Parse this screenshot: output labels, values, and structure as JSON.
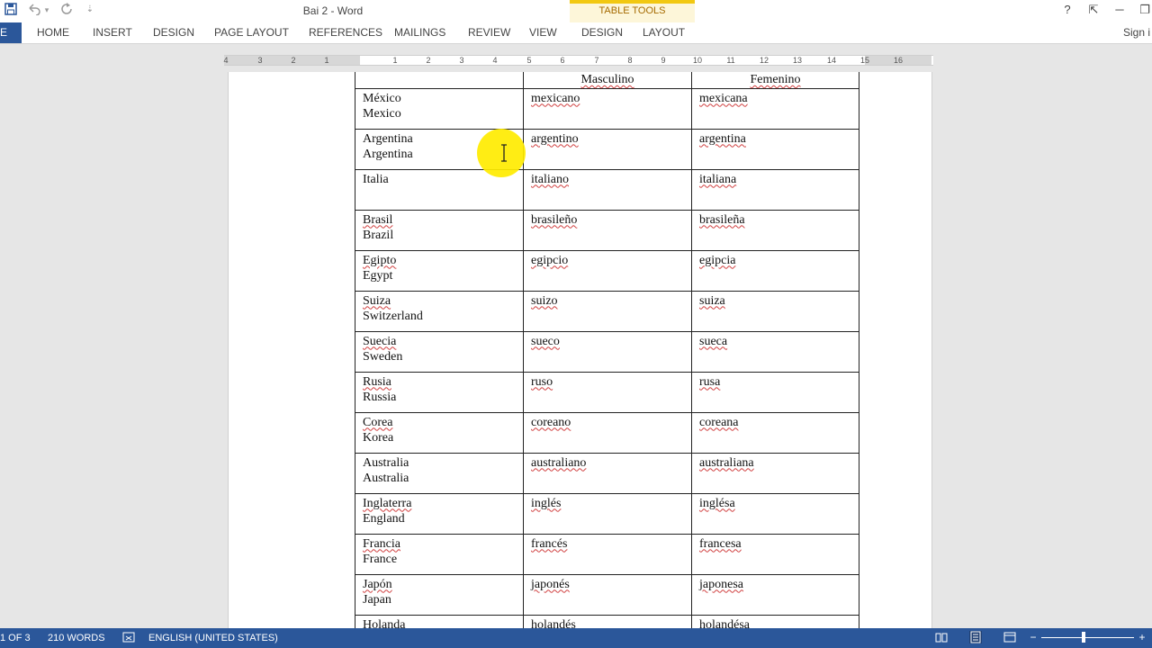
{
  "window": {
    "title": "Bai 2 - Word",
    "contextual_group": "TABLE TOOLS"
  },
  "quick_access": {
    "icons": [
      "save-icon",
      "undo-icon",
      "redo-icon",
      "customize-icon"
    ],
    "undo_dropdown": "▾",
    "customize": "⇣"
  },
  "window_controls": {
    "help": "?",
    "ribbon_display": "⇱",
    "minimize": "─",
    "restore": "❐"
  },
  "ribbon": {
    "file_tab": "E",
    "tabs": [
      "HOME",
      "INSERT",
      "DESIGN",
      "PAGE LAYOUT",
      "REFERENCES",
      "MAILINGS",
      "REVIEW",
      "VIEW"
    ],
    "context_tabs": [
      "DESIGN",
      "LAYOUT"
    ],
    "sign_in": "Sign i"
  },
  "ruler": {
    "numbers": [
      "4",
      "3",
      "2",
      "1",
      "1",
      "2",
      "3",
      "4",
      "5",
      "6",
      "7",
      "8",
      "9",
      "10",
      "11",
      "12",
      "13",
      "14",
      "15",
      "16"
    ]
  },
  "table": {
    "header": [
      "",
      "Masculino",
      "Femenino"
    ],
    "rows": [
      {
        "country_es": "México",
        "country_en": "Mexico",
        "masc": "mexicano",
        "fem": "mexicana"
      },
      {
        "country_es": "Argentina",
        "country_en": "Argentina",
        "masc": "argentino",
        "fem": "argentina"
      },
      {
        "country_es": "Italia",
        "country_en": "",
        "masc": "italiano",
        "fem": "italiana"
      },
      {
        "country_es": "Brasil",
        "country_en": "Brazil",
        "masc": "brasileño",
        "fem": "brasileña"
      },
      {
        "country_es": "Egipto",
        "country_en": "Egypt",
        "masc": "egipcio",
        "fem": "egipcia"
      },
      {
        "country_es": "Suiza",
        "country_en": "Switzerland",
        "masc": "suizo",
        "fem": "suiza"
      },
      {
        "country_es": "Suecia",
        "country_en": "Sweden",
        "masc": "sueco",
        "fem": "sueca"
      },
      {
        "country_es": "Rusia",
        "country_en": "Russia",
        "masc": "ruso",
        "fem": "rusa"
      },
      {
        "country_es": "Corea",
        "country_en": "Korea",
        "masc": "coreano",
        "fem": "coreana"
      },
      {
        "country_es": "Australia",
        "country_en": "Australia",
        "masc": "australiano",
        "fem": "australiana"
      },
      {
        "country_es": "Inglaterra",
        "country_en": "England",
        "masc": "inglés",
        "fem": "inglésa"
      },
      {
        "country_es": "Francia",
        "country_en": "France",
        "masc": "francés",
        "fem": "francesa"
      },
      {
        "country_es": "Japón",
        "country_en": "Japan",
        "masc": "japonés",
        "fem": "japonesa"
      },
      {
        "country_es": "Holanda",
        "country_en": "",
        "masc": "holandés",
        "fem": "holandésa"
      }
    ]
  },
  "status_bar": {
    "page": "1 OF 3",
    "words": "210 WORDS",
    "language": "ENGLISH (UNITED STATES)"
  },
  "colors": {
    "brand_blue": "#2b579a",
    "table_tools_yellow": "#f2c811",
    "spell_underline": "#d04040",
    "cursor_highlight": "#ffec00"
  }
}
